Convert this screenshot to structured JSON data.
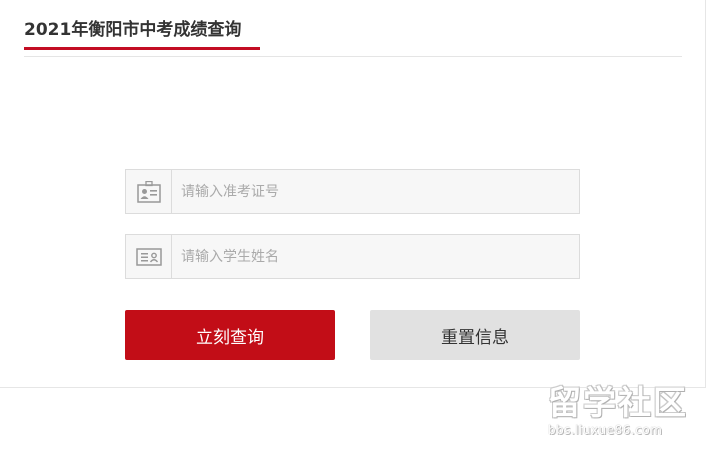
{
  "header": {
    "title": "2021年衡阳市中考成绩查询"
  },
  "form": {
    "exam_number": {
      "icon": "id-badge-icon",
      "placeholder": "请输入准考证号",
      "value": ""
    },
    "student_name": {
      "icon": "id-card-icon",
      "placeholder": "请输入学生姓名",
      "value": ""
    },
    "query_button_label": "立刻查询",
    "reset_button_label": "重置信息"
  },
  "watermark": {
    "logo_text": "留学社区",
    "url": "bbs.liuxue86.com"
  },
  "colors": {
    "accent": "#c30d23",
    "query_button": "#c20d17",
    "reset_button": "#e1e1e1"
  }
}
